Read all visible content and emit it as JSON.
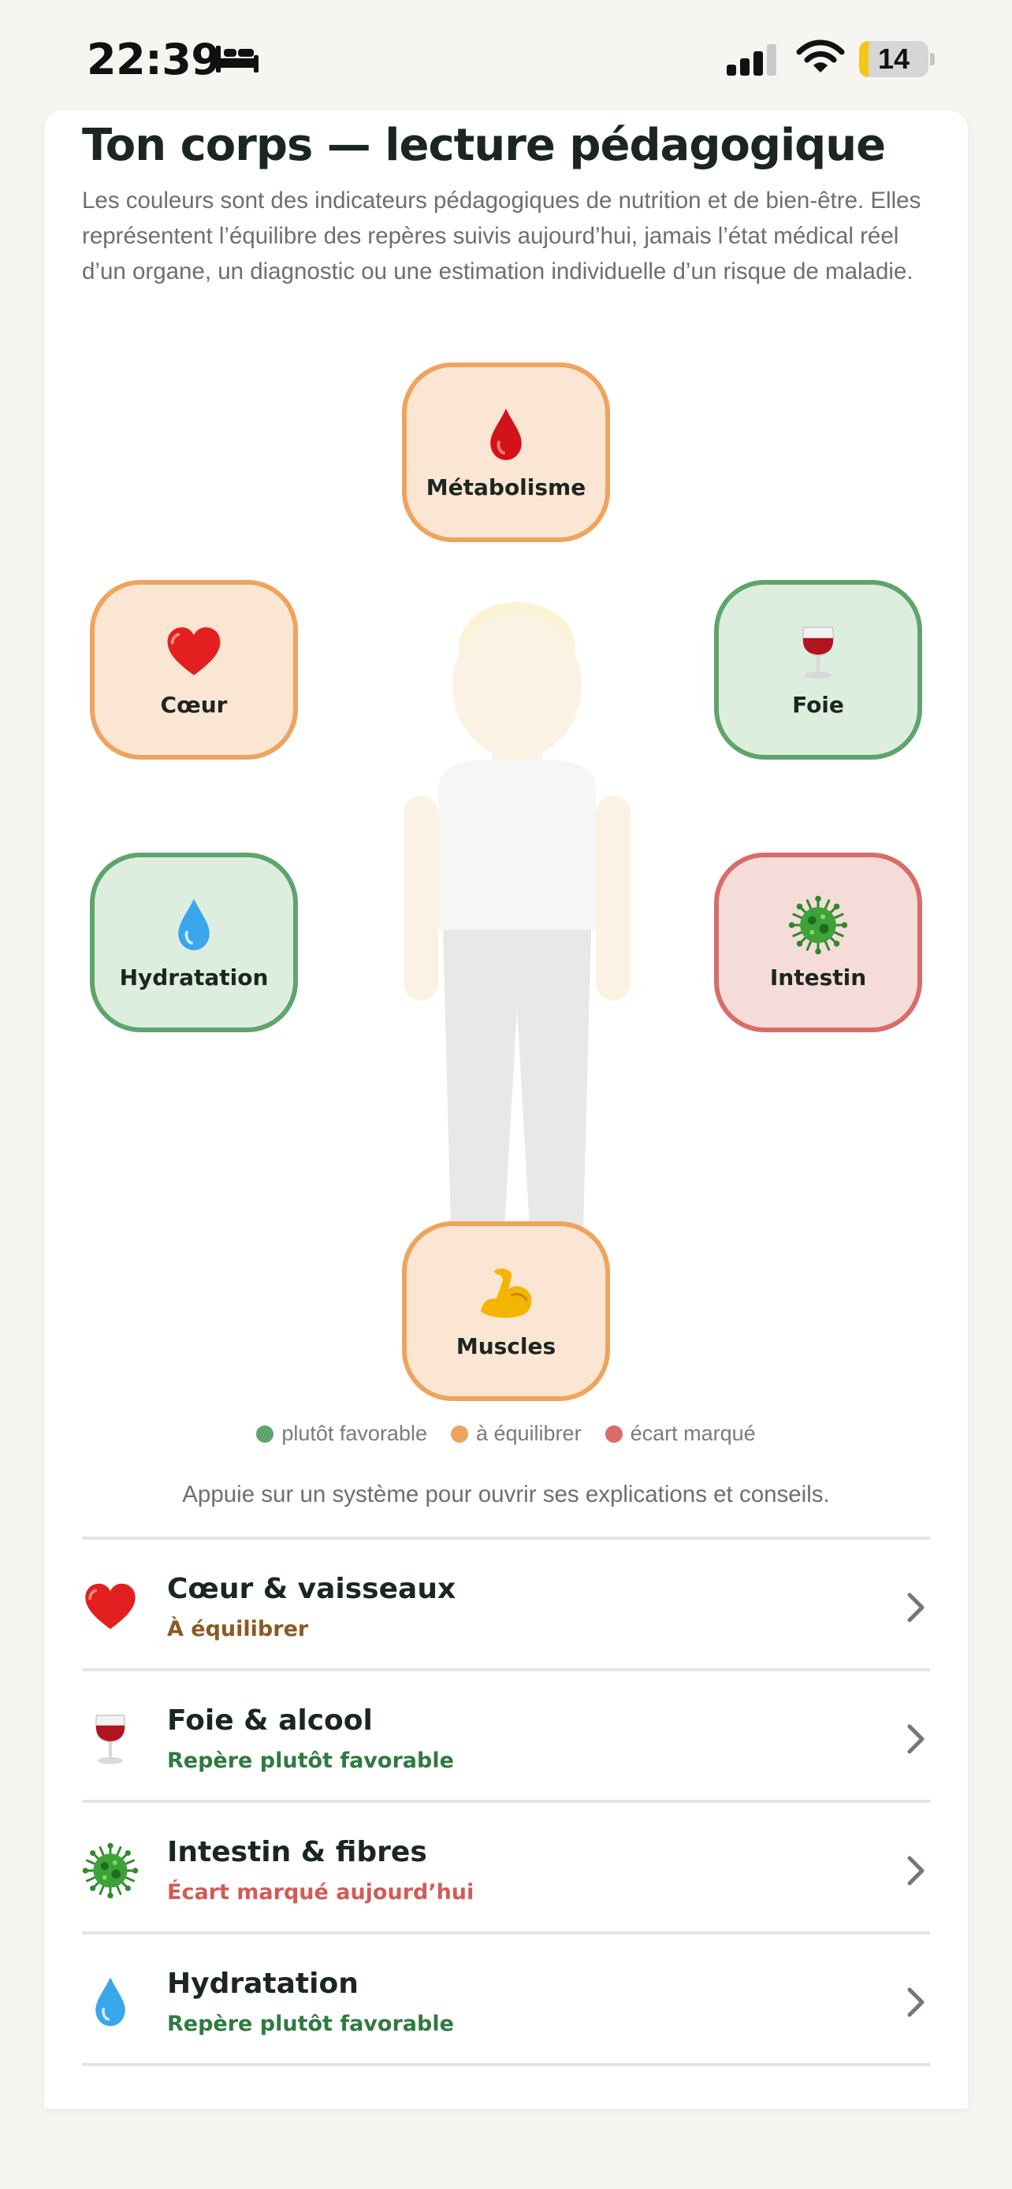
{
  "status_bar": {
    "time": "22:39",
    "battery_level": "14",
    "battery_fraction": 0.14,
    "icons": [
      "bed-icon",
      "cellular-signal-icon",
      "wifi-icon",
      "battery-icon"
    ]
  },
  "colors": {
    "favorable": "#5ea56d",
    "balance": "#efa35c",
    "gap": "#d86c69",
    "status_favorable_text": "#2f7a40",
    "status_balance_text": "#8a5a23",
    "status_gap_text": "#d15b57"
  },
  "header": {
    "title": "Ton corps — lecture pédagogique",
    "intro": "Les couleurs sont des indicateurs pédagogiques de nutrition et de bien-être. Elles représentent l’équilibre des repères suivis aujourd’hui, jamais l’état médical réel d’un organe, un diagnostic ou une estimation individuelle d’un risque de maladie."
  },
  "body_map": {
    "figure_icon": "person-silhouette-icon",
    "nodes": [
      {
        "label": "Métabolisme",
        "icon": "blood-drop-icon",
        "status": "balance"
      },
      {
        "label": "Cœur",
        "icon": "heart-icon",
        "status": "balance"
      },
      {
        "label": "Foie",
        "icon": "wine-glass-icon",
        "status": "favorable"
      },
      {
        "label": "Hydratation",
        "icon": "water-drop-icon",
        "status": "favorable"
      },
      {
        "label": "Intestin",
        "icon": "microbe-icon",
        "status": "gap"
      },
      {
        "label": "Muscles",
        "icon": "flexed-biceps-icon",
        "status": "balance"
      }
    ]
  },
  "legend": [
    {
      "label": "plutôt favorable",
      "color": "#5ea56d"
    },
    {
      "label": "à équilibrer",
      "color": "#efa35c"
    },
    {
      "label": "écart marqué",
      "color": "#d86c69"
    }
  ],
  "hint": "Appuie sur un système pour ouvrir ses explications et conseils.",
  "systems": [
    {
      "title": "Cœur & vaisseaux",
      "status": "À équilibrer",
      "icon": "heart-icon",
      "status_color": "#8a5a23"
    },
    {
      "title": "Foie & alcool",
      "status": "Repère plutôt favorable",
      "icon": "wine-glass-icon",
      "status_color": "#2f7a40"
    },
    {
      "title": "Intestin & fibres",
      "status": "Écart marqué aujourd’hui",
      "icon": "microbe-icon",
      "status_color": "#d15b57"
    },
    {
      "title": "Hydratation",
      "status": "Repère plutôt favorable",
      "icon": "water-drop-icon",
      "status_color": "#2f7a40"
    }
  ]
}
